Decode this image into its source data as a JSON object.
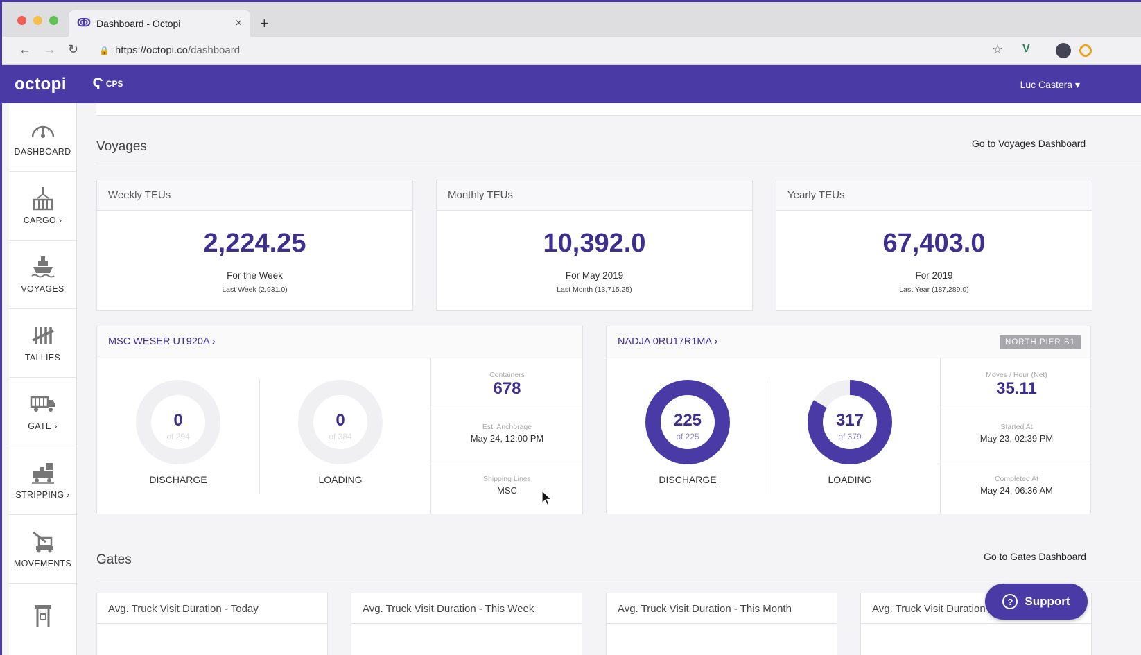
{
  "browser": {
    "tab_title": "Dashboard - Octopi",
    "tab_close": "×",
    "new_tab": "+",
    "url_host": "https://octopi.co",
    "url_path": "/dashboard"
  },
  "app": {
    "logo": "octopi",
    "brand_badge": "CPS",
    "user_menu": "Luc Castera ▾",
    "brand_color": "#4a3aa6",
    "value_color": "#3e2f8f"
  },
  "sidebar": {
    "items": [
      {
        "label": "DASHBOARD",
        "icon": "gauge-icon"
      },
      {
        "label": "CARGO ›",
        "icon": "cargo-crane-icon"
      },
      {
        "label": "VOYAGES",
        "icon": "ship-icon"
      },
      {
        "label": "TALLIES",
        "icon": "tally-icon"
      },
      {
        "label": "GATE ›",
        "icon": "truck-icon"
      },
      {
        "label": "STRIPPING ›",
        "icon": "forklift-icon"
      },
      {
        "label": "MOVEMENTS",
        "icon": "reach-stacker-icon"
      },
      {
        "label": "",
        "icon": "gantry-crane-icon"
      }
    ]
  },
  "voyages": {
    "title": "Voyages",
    "link": "Go to Voyages Dashboard",
    "teu_cards": [
      {
        "title": "Weekly TEUs",
        "value": "2,224.25",
        "period": "For the Week",
        "last": "Last Week (2,931.0)"
      },
      {
        "title": "Monthly TEUs",
        "value": "10,392.0",
        "period": "For May 2019",
        "last": "Last Month (13,715.25)"
      },
      {
        "title": "Yearly TEUs",
        "value": "67,403.0",
        "period": "For 2019",
        "last": "Last Year (187,289.0)"
      }
    ],
    "vessels": [
      {
        "name": "MSC WESER UT920A ›",
        "badge": "",
        "discharge": {
          "value": "0",
          "of": "of 294",
          "label": "DISCHARGE",
          "fraction": 0
        },
        "loading": {
          "value": "0",
          "of": "of 384",
          "label": "LOADING",
          "fraction": 0
        },
        "stats": [
          {
            "label": "Containers",
            "value": "678"
          },
          {
            "label": "Est. Anchorage",
            "value": "May 24, 12:00 PM"
          },
          {
            "label": "Shipping Lines",
            "value": "MSC"
          }
        ]
      },
      {
        "name": "NADJA 0RU17R1MA ›",
        "badge": "NORTH PIER B1",
        "discharge": {
          "value": "225",
          "of": "of 225",
          "label": "DISCHARGE",
          "fraction": 1.0
        },
        "loading": {
          "value": "317",
          "of": "of 379",
          "label": "LOADING",
          "fraction": 0.836
        },
        "stats": [
          {
            "label": "Moves / Hour (Net)",
            "value": "35.11"
          },
          {
            "label": "Started At",
            "value": "May 23, 02:39 PM"
          },
          {
            "label": "Completed At",
            "value": "May 24, 06:36 AM"
          }
        ]
      }
    ]
  },
  "gates": {
    "title": "Gates",
    "link": "Go to Gates Dashboard",
    "cards": [
      {
        "title": "Avg. Truck Visit Duration - Today"
      },
      {
        "title": "Avg. Truck Visit Duration - This Week"
      },
      {
        "title": "Avg. Truck Visit Duration - This Month"
      },
      {
        "title": "Avg. Truck Visit Duration"
      }
    ]
  },
  "support": {
    "label": "Support",
    "icon": "help-icon",
    "glyph": "?"
  }
}
